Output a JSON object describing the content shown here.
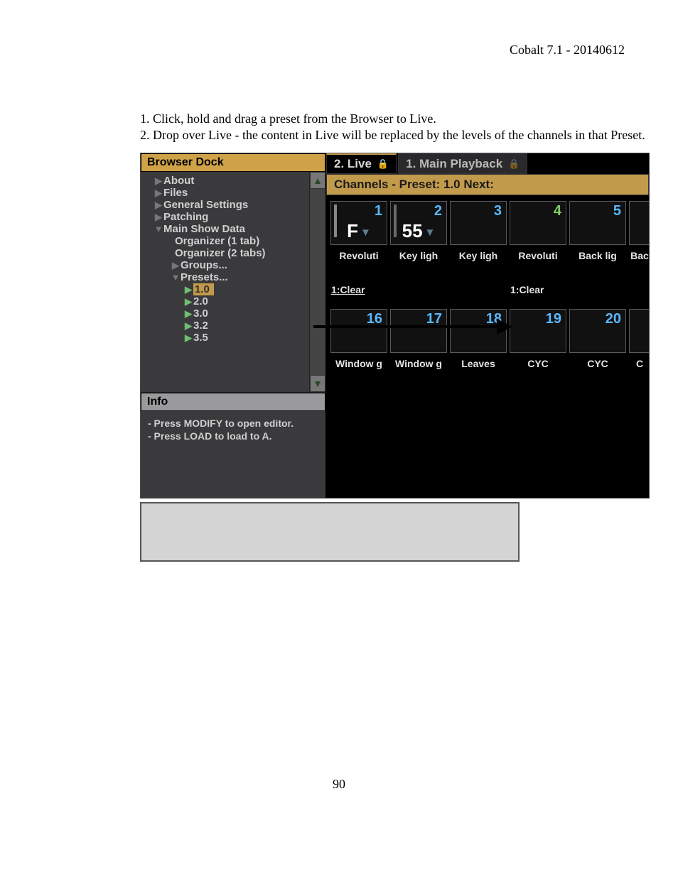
{
  "page": {
    "header": "Cobalt 7.1 - 20140612",
    "footer_page": "90",
    "instructions": {
      "line1": "1. Click, hold and drag a preset from the Browser to Live.",
      "line2": "2. Drop over Live - the content in Live will be replaced by the levels of the channels in that Preset."
    }
  },
  "browser": {
    "title": "Browser Dock",
    "tree": {
      "about": {
        "label": "About",
        "indent": 18,
        "glyph": "▶"
      },
      "files": {
        "label": "Files",
        "indent": 18,
        "glyph": "▶"
      },
      "general": {
        "label": "General Settings",
        "indent": 18,
        "glyph": "▶"
      },
      "patching": {
        "label": "Patching",
        "indent": 18,
        "glyph": "▶"
      },
      "mainshow": {
        "label": "Main Show Data",
        "indent": 18,
        "glyph": "▼"
      },
      "org1": {
        "label": "Organizer (1 tab)",
        "indent": 48,
        "glyph": ""
      },
      "org2": {
        "label": "Organizer (2 tabs)",
        "indent": 48,
        "glyph": ""
      },
      "groups": {
        "label": "Groups...",
        "indent": 42,
        "glyph": "▶"
      },
      "presets": {
        "label": "Presets...",
        "indent": 42,
        "glyph": "▼"
      },
      "p10": {
        "label": "1.0",
        "indent": 60,
        "glyph": "▶",
        "sel": true
      },
      "p20": {
        "label": "2.0",
        "indent": 60,
        "glyph": "▶"
      },
      "p30": {
        "label": "3.0",
        "indent": 60,
        "glyph": "▶"
      },
      "p32": {
        "label": "3.2",
        "indent": 60,
        "glyph": "▶"
      },
      "p35": {
        "label": "3.5",
        "indent": 60,
        "glyph": "▶"
      }
    }
  },
  "info": {
    "title": "Info",
    "line1": "- Press MODIFY to open editor.",
    "line2": "- Press LOAD to load to A."
  },
  "tabs": {
    "live": "2. Live",
    "main": "1. Main Playback"
  },
  "channels": {
    "header": "Channels - Preset: 1.0  Next:",
    "top_row": {
      "c1": {
        "num": "1",
        "val": "F"
      },
      "c2": {
        "num": "2",
        "val": "55"
      },
      "c3": {
        "num": "3",
        "val": ""
      },
      "c4": {
        "num": "4",
        "val": ""
      },
      "c5": {
        "num": "5",
        "val": ""
      }
    },
    "top_labels": {
      "l1": "Revoluti",
      "l2": "Key ligh",
      "l3": "Key ligh",
      "l4": "Revoluti",
      "l5": "Back lig",
      "l6": "Bac"
    },
    "clear_row": {
      "c1": "1:Clear",
      "c4": "1:Clear"
    },
    "mid_row": {
      "c1": {
        "num": "16"
      },
      "c2": {
        "num": "17"
      },
      "c3": {
        "num": "18"
      },
      "c4": {
        "num": "19"
      },
      "c5": {
        "num": "20"
      }
    },
    "mid_labels": {
      "l1": "Window g",
      "l2": "Window g",
      "l3": "Leaves",
      "l4": "CYC",
      "l5": "CYC",
      "l6": "C"
    }
  }
}
